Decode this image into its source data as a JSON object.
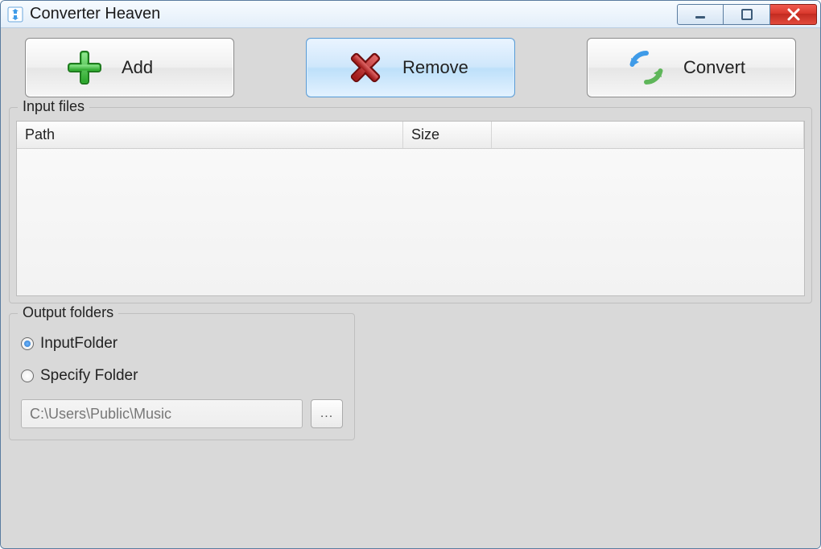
{
  "window": {
    "title": "Converter Heaven"
  },
  "toolbar": {
    "add_label": "Add",
    "remove_label": "Remove",
    "convert_label": "Convert",
    "active_button": "remove"
  },
  "input_files": {
    "group_label": "Input files",
    "columns": {
      "path": "Path",
      "size": "Size"
    },
    "rows": []
  },
  "output": {
    "group_label": "Output folders",
    "options": {
      "input_folder": "InputFolder",
      "specify_folder": "Specify Folder"
    },
    "selected": "input_folder",
    "path_value": "C:\\Users\\Public\\Music",
    "browse_label": "..."
  }
}
